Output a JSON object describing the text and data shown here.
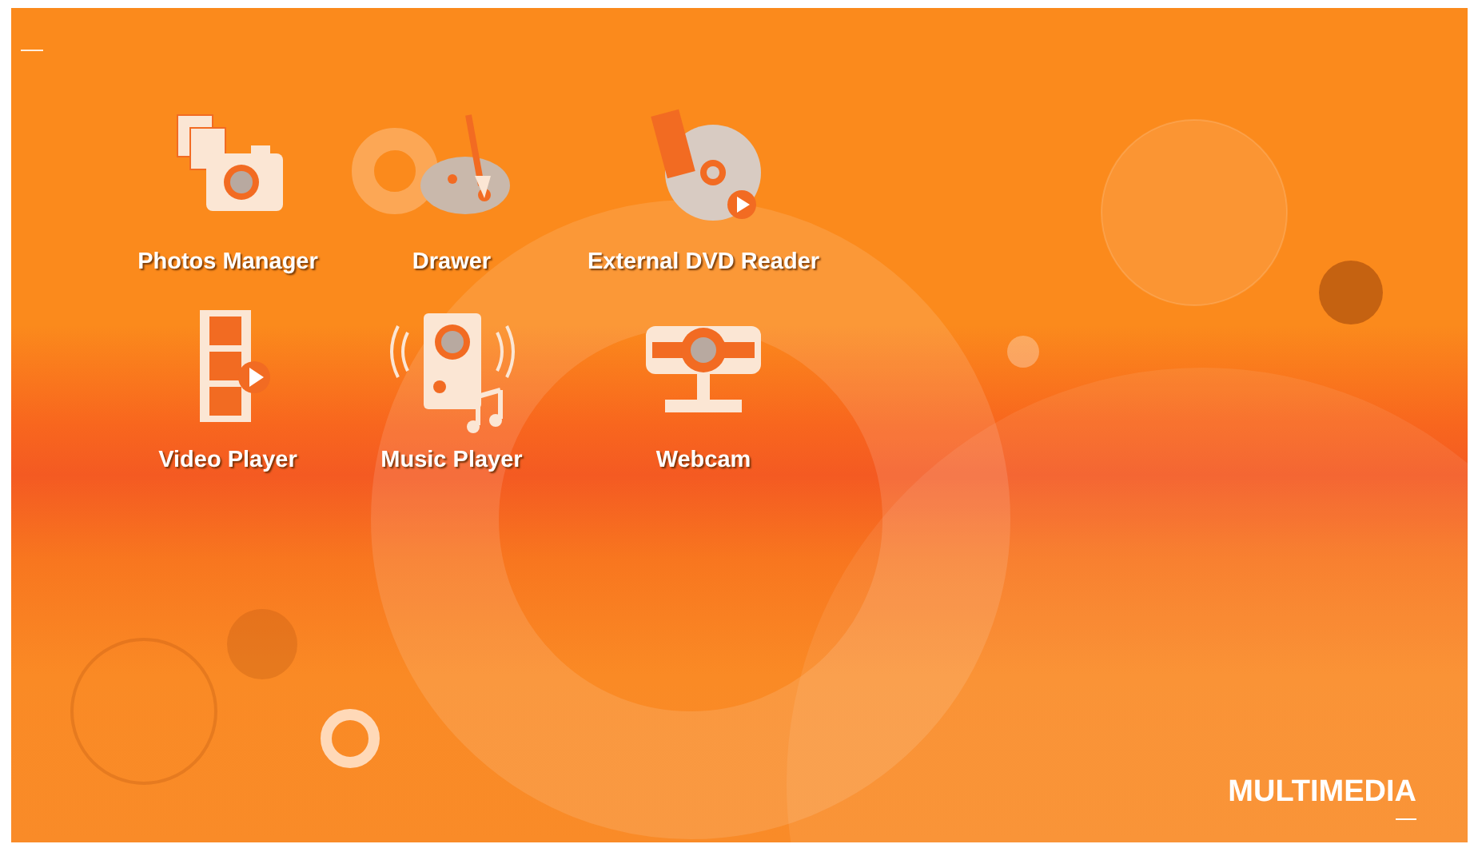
{
  "apps": [
    {
      "label": "Photos Manager",
      "kind": "photos"
    },
    {
      "label": "Drawer",
      "kind": "drawer"
    },
    {
      "label": "External DVD Reader",
      "kind": "dvd"
    },
    {
      "label": "Video Player",
      "kind": "video"
    },
    {
      "label": "Music Player",
      "kind": "music"
    },
    {
      "label": "Webcam",
      "kind": "webcam"
    }
  ],
  "section_title": "MULTIMEDIA"
}
